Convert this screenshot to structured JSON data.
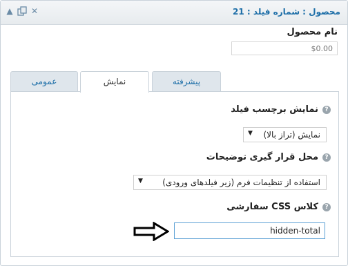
{
  "header": {
    "title": "محصول : شماره فیلد : 21"
  },
  "product": {
    "label": "نام محصول",
    "price_placeholder": "$0.00"
  },
  "tabs": [
    {
      "label": "پیشرفته"
    },
    {
      "label": "نمایش"
    },
    {
      "label": "عمومی"
    }
  ],
  "fields": {
    "label_display": {
      "label": "نمایش برچسب فیلد",
      "value": "نمایش (تراز بالا)"
    },
    "description_position": {
      "label": "محل قرار گیری توضیحات",
      "value": "استفاده از تنظیمات فرم (زیر فیلدهای ورودی)"
    },
    "css_class": {
      "label": "کلاس CSS سفارشی",
      "value": "hidden-total"
    }
  }
}
